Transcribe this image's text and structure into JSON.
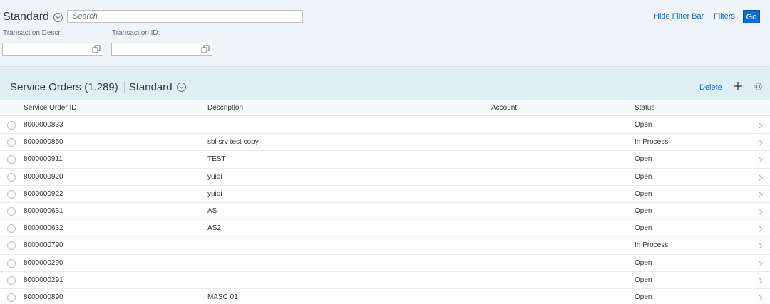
{
  "filterbar": {
    "variant_title": "Standard",
    "search_placeholder": "Search",
    "hide_filter_bar": "Hide Filter Bar",
    "filters": "Filters",
    "go": "Go",
    "fields": [
      {
        "label": "Transaction Descr.:",
        "value": ""
      },
      {
        "label": "Transaction ID:",
        "value": ""
      }
    ]
  },
  "table": {
    "title": "Service Orders (1.289)",
    "variant": "Standard",
    "delete_label": "Delete",
    "columns": [
      "Service Order ID",
      "Description",
      "Account",
      "Status"
    ],
    "rows": [
      {
        "id": "8000000833",
        "description": "",
        "account": "",
        "status": "Open"
      },
      {
        "id": "8000000850",
        "description": "sbl srv test copy",
        "account": "",
        "status": "In Process"
      },
      {
        "id": "8000000911",
        "description": "TEST",
        "account": "",
        "status": "Open"
      },
      {
        "id": "8000000920",
        "description": "yuioi",
        "account": "",
        "status": "Open"
      },
      {
        "id": "8000000922",
        "description": "yuioi",
        "account": "",
        "status": "Open"
      },
      {
        "id": "8000000631",
        "description": "AS",
        "account": "",
        "status": "Open"
      },
      {
        "id": "8000000632",
        "description": "AS2",
        "account": "",
        "status": "Open"
      },
      {
        "id": "8000000790",
        "description": "",
        "account": "",
        "status": "In Process"
      },
      {
        "id": "8000000290",
        "description": "",
        "account": "",
        "status": "Open"
      },
      {
        "id": "8000000291",
        "description": "",
        "account": "",
        "status": "Open"
      },
      {
        "id": "8000000890",
        "description": "MASC 01",
        "account": "",
        "status": "Open"
      }
    ]
  },
  "icons": {
    "variant_chevron": "chevron-down-circle-icon",
    "value_help": "value-help-icon",
    "add": "plus-icon",
    "settings": "gear-icon",
    "row_nav": "chevron-right-icon"
  },
  "colors": {
    "accent": "#0a6ed1",
    "header_bg": "#dfeff3",
    "filter_bg": "#eff4f9"
  }
}
